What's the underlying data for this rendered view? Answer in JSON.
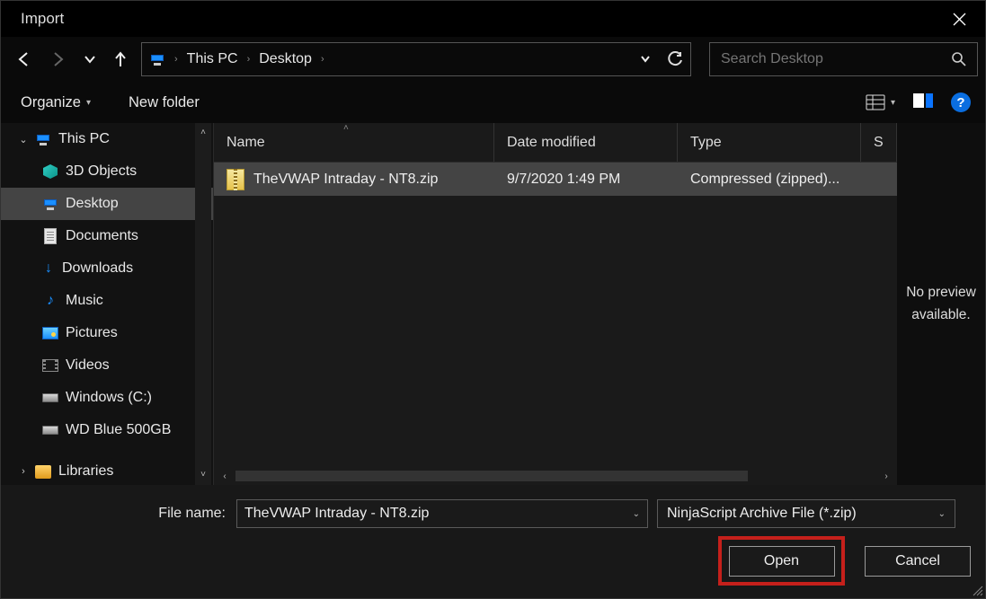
{
  "title": "Import",
  "breadcrumb": {
    "root": "This PC",
    "current": "Desktop"
  },
  "search": {
    "placeholder": "Search Desktop"
  },
  "toolbar": {
    "organize": "Organize",
    "newfolder": "New folder"
  },
  "tree": {
    "root": "This PC",
    "items": [
      {
        "label": "3D Objects"
      },
      {
        "label": "Desktop",
        "selected": true
      },
      {
        "label": "Documents"
      },
      {
        "label": "Downloads"
      },
      {
        "label": "Music"
      },
      {
        "label": "Pictures"
      },
      {
        "label": "Videos"
      },
      {
        "label": "Windows (C:)"
      },
      {
        "label": "WD Blue 500GB"
      }
    ],
    "libraries": "Libraries"
  },
  "columns": {
    "name": "Name",
    "date": "Date modified",
    "type": "Type",
    "size": "S"
  },
  "files": [
    {
      "name": "TheVWAP Intraday - NT8.zip",
      "date": "9/7/2020 1:49 PM",
      "type": "Compressed (zipped)..."
    }
  ],
  "preview": "No preview available.",
  "footer": {
    "filename_label": "File name:",
    "filename_value": "TheVWAP Intraday - NT8.zip",
    "filter": "NinjaScript Archive File (*.zip)",
    "open": "Open",
    "cancel": "Cancel"
  }
}
